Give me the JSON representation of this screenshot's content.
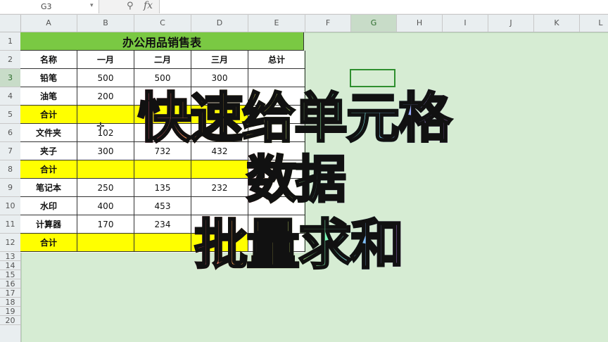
{
  "formula_bar": {
    "name_box": "G3",
    "fx_label": "fx"
  },
  "columns": [
    "A",
    "B",
    "C",
    "D",
    "E",
    "F",
    "G",
    "H",
    "I",
    "J",
    "K",
    "L"
  ],
  "rows": [
    "1",
    "2",
    "3",
    "4",
    "5",
    "6",
    "7",
    "8",
    "9",
    "10",
    "11",
    "12",
    "13",
    "14",
    "15",
    "16",
    "17",
    "18",
    "19",
    "20"
  ],
  "sheet": {
    "title": "办公用品销售表",
    "headers": [
      "名称",
      "一月",
      "二月",
      "三月",
      "总计"
    ],
    "rows": [
      {
        "name": "铅笔",
        "jan": "500",
        "feb": "500",
        "mar": "300",
        "total": "",
        "subtotal": false
      },
      {
        "name": "油笔",
        "jan": "200",
        "feb": "",
        "mar": "",
        "total": "",
        "subtotal": false
      },
      {
        "name": "合计",
        "jan": "",
        "feb": "",
        "mar": "",
        "total": "",
        "subtotal": true
      },
      {
        "name": "文件夹",
        "jan": "102",
        "feb": "",
        "mar": "",
        "total": "",
        "subtotal": false
      },
      {
        "name": "夹子",
        "jan": "300",
        "feb": "732",
        "mar": "432",
        "total": "",
        "subtotal": false
      },
      {
        "name": "合计",
        "jan": "",
        "feb": "",
        "mar": "",
        "total": "",
        "subtotal": true
      },
      {
        "name": "笔记本",
        "jan": "250",
        "feb": "135",
        "mar": "232",
        "total": "",
        "subtotal": false
      },
      {
        "name": "水印",
        "jan": "400",
        "feb": "453",
        "mar": "",
        "total": "",
        "subtotal": false
      },
      {
        "name": "计算器",
        "jan": "170",
        "feb": "234",
        "mar": "",
        "total": "",
        "subtotal": false
      },
      {
        "name": "合计",
        "jan": "",
        "feb": "",
        "mar": "",
        "total": "",
        "subtotal": true
      }
    ]
  },
  "overlay": {
    "line1": "快速给单元格",
    "line2": "数据",
    "line3": "批量求和"
  },
  "colors": {
    "title_fill": "#7ac943",
    "subtotal_fill": "#ffff00",
    "sheet_bg": "#d6ecd3"
  }
}
